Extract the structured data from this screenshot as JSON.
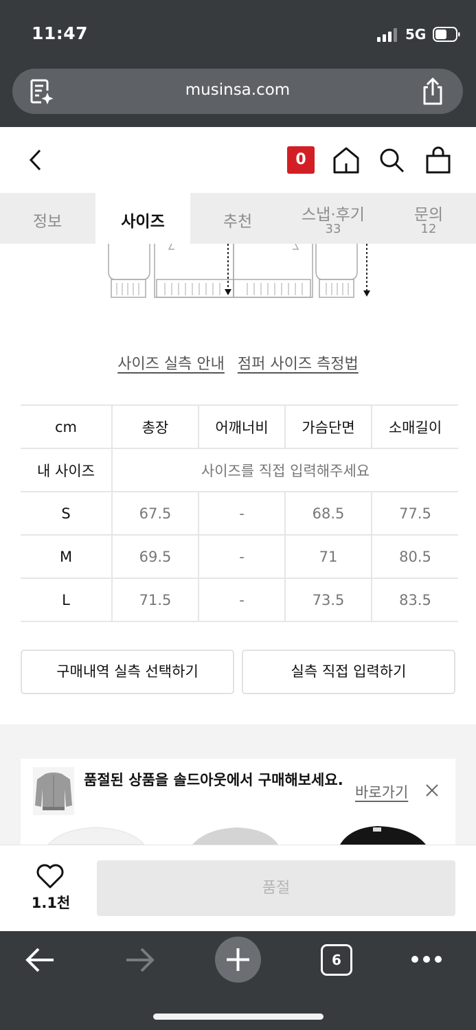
{
  "status_bar": {
    "time": "11:47",
    "network": "5G"
  },
  "browser": {
    "url": "musinsa.com"
  },
  "header": {
    "cart_count": "0"
  },
  "tabs": [
    {
      "label": "정보"
    },
    {
      "label": "사이즈"
    },
    {
      "label": "추천"
    },
    {
      "label": "스냅·후기",
      "count": "33"
    },
    {
      "label": "문의",
      "count": "12"
    }
  ],
  "guide": {
    "measure_info": "사이즈 실측 안내",
    "jumper_method": "점퍼 사이즈 측정법"
  },
  "size_table": {
    "headers": [
      "cm",
      "총장",
      "어깨너비",
      "가슴단면",
      "소매길이"
    ],
    "my_size": {
      "label": "내 사이즈",
      "placeholder": "사이즈를 직접 입력해주세요"
    },
    "rows": [
      {
        "size": "S",
        "values": [
          "67.5",
          "-",
          "68.5",
          "77.5"
        ]
      },
      {
        "size": "M",
        "values": [
          "69.5",
          "-",
          "71",
          "80.5"
        ]
      },
      {
        "size": "L",
        "values": [
          "71.5",
          "-",
          "73.5",
          "83.5"
        ]
      }
    ]
  },
  "buttons": {
    "history": "구매내역 실측 선택하기",
    "direct": "실측 직접 입력하기"
  },
  "banner": {
    "text": "품절된 상품을 솔드아웃에서 구매해보세요.",
    "link": "바로가기"
  },
  "purchase": {
    "like_count": "1.1천",
    "soldout": "품절"
  },
  "toolbar": {
    "tab_count": "6"
  },
  "colors": {
    "brand_red": "#d21f26",
    "chrome": "#373b3e"
  }
}
